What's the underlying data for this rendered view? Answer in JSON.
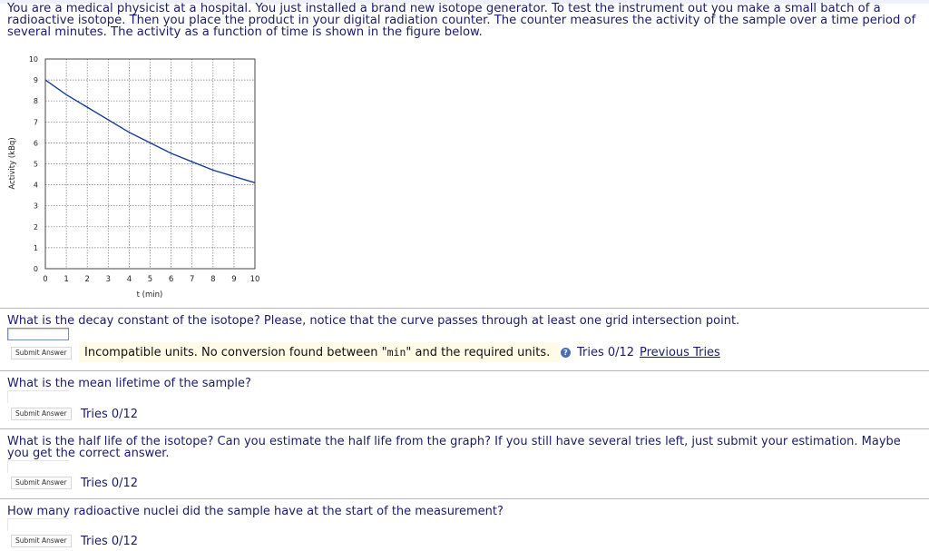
{
  "intro_text": "You are a medical physicist at a hospital. You just installed a brand new isotope generator. To test the instrument out you make a small batch of a radioactive isotope. Then you place the product in your digital radiation counter. The counter measures the activity of the sample over a time period of several minutes. The activity as a function of time is shown in the figure below.",
  "chart_data": {
    "type": "line",
    "xlabel": "t (min)",
    "ylabel": "Activity (kBq)",
    "xlim": [
      0,
      10
    ],
    "ylim": [
      0,
      10
    ],
    "x_ticks": [
      "0",
      "1",
      "2",
      "3",
      "4",
      "5",
      "6",
      "7",
      "8",
      "9",
      "10"
    ],
    "y_ticks": [
      "0",
      "1",
      "2",
      "3",
      "4",
      "5",
      "6",
      "7",
      "8",
      "9",
      "10"
    ],
    "grid": true,
    "series": [
      {
        "x": [
          0,
          1,
          2,
          3,
          4,
          5,
          6,
          7,
          8,
          9,
          10
        ],
        "y": [
          9.0,
          8.3,
          7.7,
          7.1,
          6.5,
          6.0,
          5.5,
          5.1,
          4.7,
          4.4,
          4.1
        ],
        "color": "#1a3d99"
      }
    ]
  },
  "questions": [
    {
      "text": "What is the decay constant of the isotope? Please, notice that the curve passes through at least one grid intersection point.",
      "input_value": "",
      "submit_label": "Submit Answer",
      "feedback_prefix": "Incompatible units. No conversion found between \"",
      "feedback_unit": "min",
      "feedback_suffix": "\" and the required units.",
      "tries": "Tries 0/12",
      "previous_tries_label": "Previous Tries",
      "help_icon": "help-icon"
    },
    {
      "text": "What is the mean lifetime of the sample?",
      "input_value": "",
      "submit_label": "Submit Answer",
      "tries": "Tries 0/12"
    },
    {
      "text": "What is the half life of the isotope? Can you estimate the half life from the graph? If you still have several tries left, just submit your estimation. Maybe you get the correct answer.",
      "input_value": "",
      "submit_label": "Submit Answer",
      "tries": "Tries 0/12"
    },
    {
      "text": "How many radioactive nuclei did the sample have at the start of the measurement?",
      "input_value": "",
      "submit_label": "Submit Answer",
      "tries": "Tries 0/12"
    }
  ]
}
